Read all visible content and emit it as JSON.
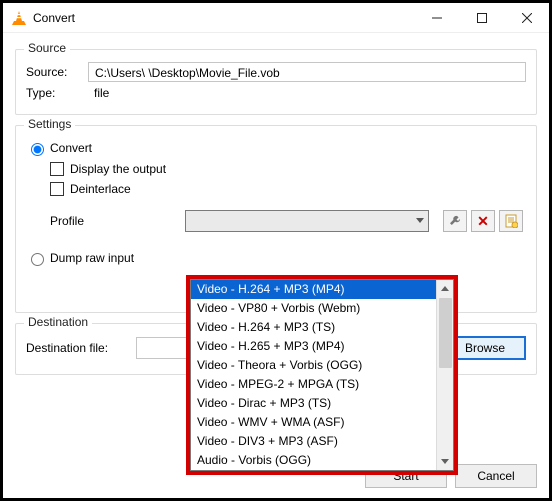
{
  "window": {
    "title": "Convert"
  },
  "source_group": {
    "label": "Source",
    "source_label": "Source:",
    "source_value": "C:\\Users\\          \\Desktop\\Movie_File.vob",
    "type_label": "Type:",
    "type_value": "file"
  },
  "settings_group": {
    "label": "Settings",
    "convert_radio": "Convert",
    "display_output": "Display the output",
    "deinterlace": "Deinterlace",
    "profile_label": "Profile",
    "dump_raw": "Dump raw input",
    "icon_wrench": "wrench-icon",
    "icon_delete": "delete-icon",
    "icon_new": "new-profile-icon"
  },
  "profile_dropdown": {
    "selected_index": 0,
    "options": [
      "Video - H.264 + MP3 (MP4)",
      "Video - VP80 + Vorbis (Webm)",
      "Video - H.264 + MP3 (TS)",
      "Video - H.265 + MP3 (MP4)",
      "Video - Theora + Vorbis (OGG)",
      "Video - MPEG-2 + MPGA (TS)",
      "Video - Dirac + MP3 (TS)",
      "Video - WMV + WMA (ASF)",
      "Video - DIV3 + MP3 (ASF)",
      "Audio - Vorbis (OGG)"
    ]
  },
  "destination_group": {
    "label": "Destination",
    "dest_file_label": "Destination file:",
    "dest_file_value": "",
    "browse": "Browse"
  },
  "footer": {
    "start": "Start",
    "cancel": "Cancel"
  }
}
